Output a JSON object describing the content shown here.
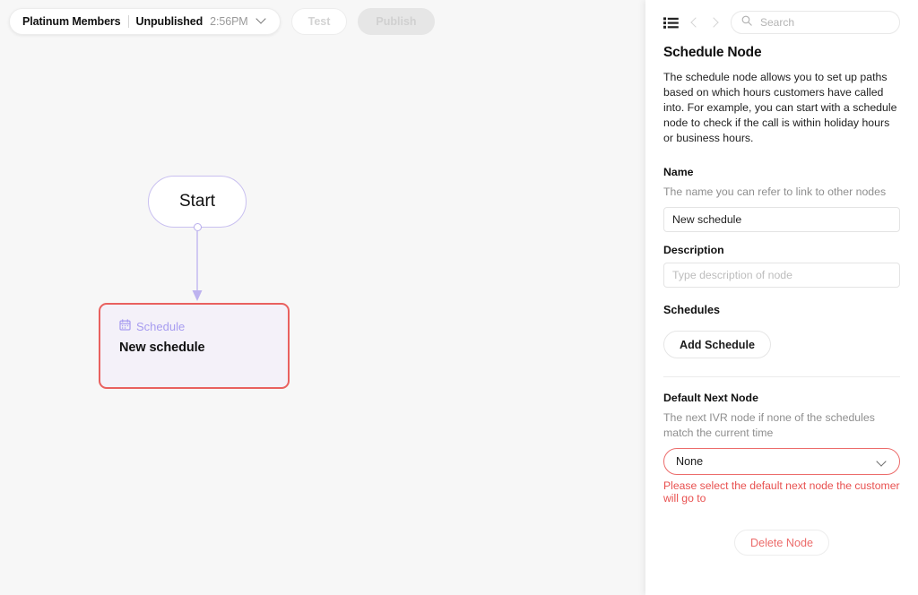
{
  "toolbar": {
    "flow_name": "Platinum Members",
    "status": "Unpublished",
    "time": "2:56PM",
    "dropdown_icon": "chevron-down-icon",
    "test_label": "Test",
    "publish_label": "Publish"
  },
  "canvas": {
    "nodes": [
      {
        "id": "start",
        "label": "Start"
      },
      {
        "id": "schedule",
        "type_label": "Schedule",
        "type_icon": "calendar-icon",
        "title": "New schedule"
      }
    ]
  },
  "panel": {
    "header": {
      "list_icon": "list-icon",
      "back_icon": "chevron-left-icon",
      "forward_icon": "chevron-right-icon",
      "search_placeholder": "Search",
      "search_value": "",
      "search_icon": "search-icon"
    },
    "title": "Schedule Node",
    "description": "The schedule node allows you to set up paths based on which hours customers have called into. For example, you can start with a schedule node to check if the call is within holiday hours or business hours.",
    "name_field": {
      "label": "Name",
      "help": "The name you can refer to link to other nodes",
      "value": "New schedule",
      "placeholder": ""
    },
    "description_field": {
      "label": "Description",
      "value": "",
      "placeholder": "Type description of node"
    },
    "schedules": {
      "label": "Schedules",
      "add_button": "Add Schedule"
    },
    "default_next_node": {
      "label": "Default Next Node",
      "help": "The next IVR node if none of the schedules match the current time",
      "selected": "None",
      "chevron_icon": "chevron-down-icon",
      "error": "Please select the default next node the customer will go to"
    },
    "delete_button": "Delete Node"
  },
  "colors": {
    "canvas_bg": "#f7f7f7",
    "node_border_error": "#e9615f",
    "node_fill": "#f4f1f9",
    "accent_purple": "#a79cf0",
    "error_red": "#e8504f",
    "edge": "#bdb2ef"
  }
}
